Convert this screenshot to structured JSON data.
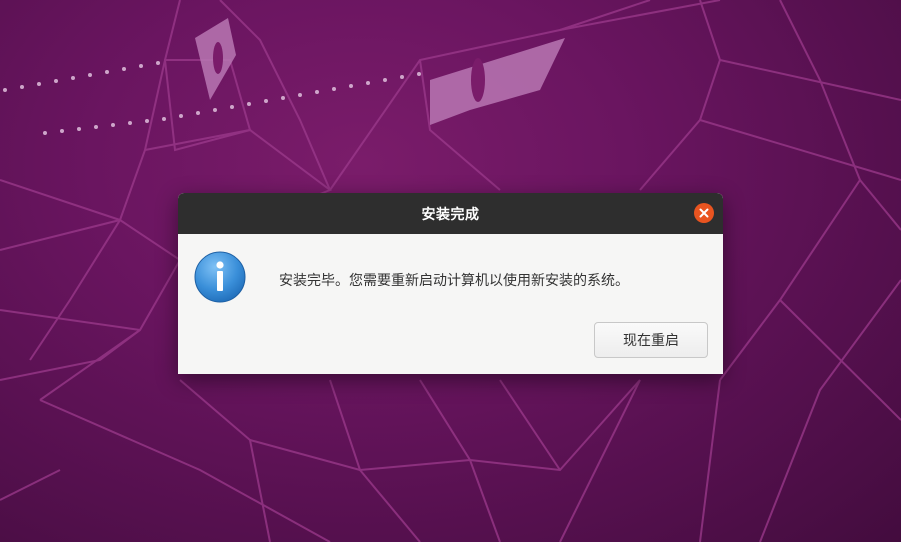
{
  "dialog": {
    "title": "安装完成",
    "message": "安装完毕。您需要重新启动计算机以使用新安装的系统。",
    "restart_label": "现在重启"
  },
  "icons": {
    "info": "info-icon",
    "close": "close-icon"
  },
  "colors": {
    "wallpaper": "#6a1560",
    "titlebar": "#2e2e2e",
    "close_button": "#e95420",
    "info_icon": "#3a8fd9",
    "dialog_background": "#f6f6f5"
  }
}
